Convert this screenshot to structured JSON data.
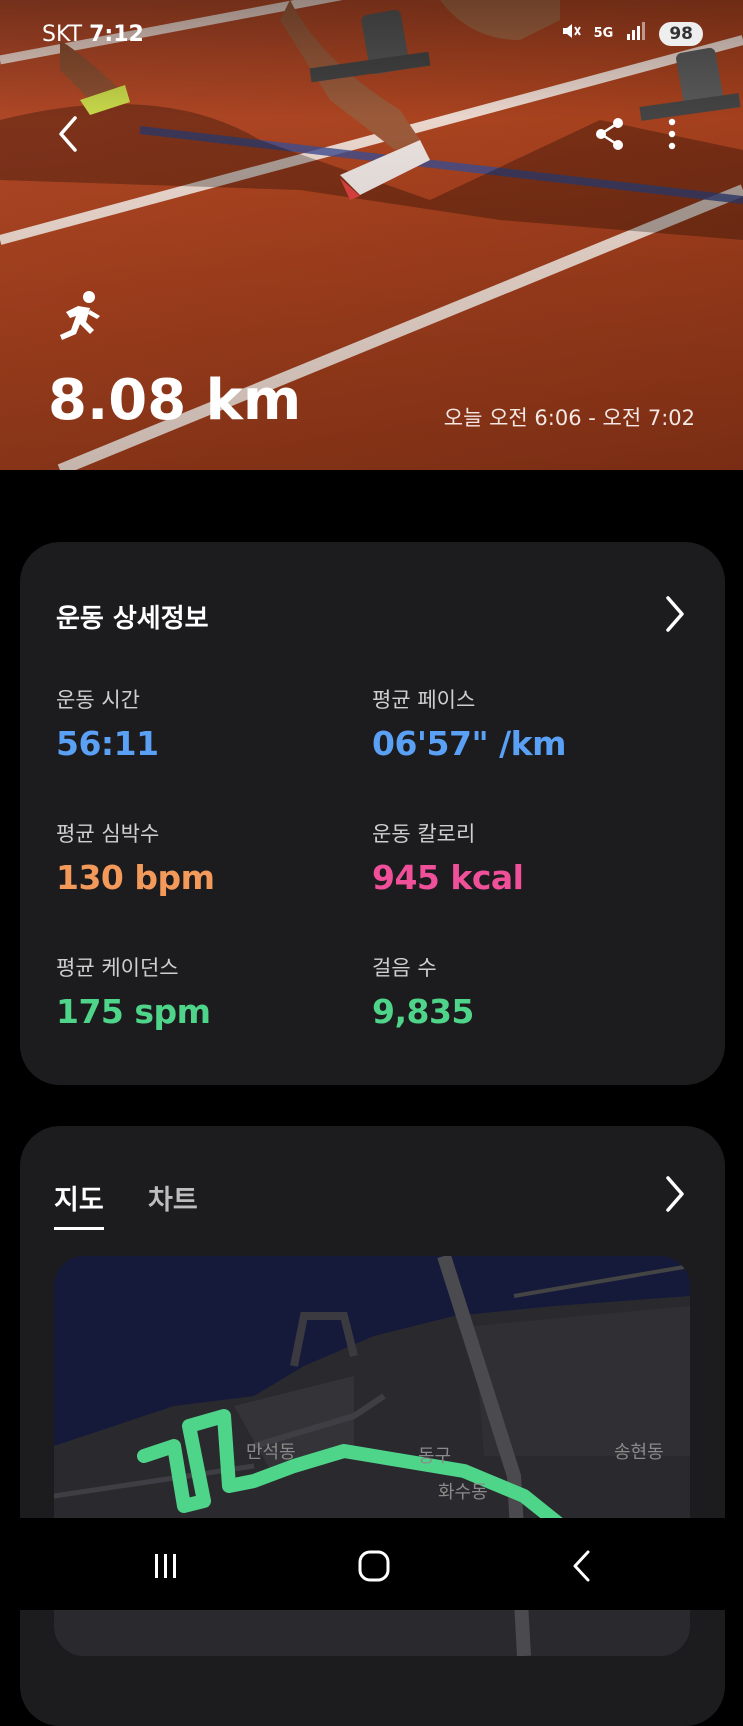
{
  "status_bar": {
    "carrier": "SKT",
    "time": "7:12",
    "network": "5G",
    "battery": "98"
  },
  "header": {
    "activity_icon": "running-person-icon",
    "distance": "8.08 km",
    "time_range": "오늘 오전 6:06 - 오전 7:02"
  },
  "details": {
    "title": "운동 상세정보",
    "metrics": [
      {
        "label": "운동 시간",
        "value": "56:11",
        "color": "#5aa0f5"
      },
      {
        "label": "평균 페이스",
        "value": "06'57\" /km",
        "color": "#5aa0f5"
      },
      {
        "label": "평균 심박수",
        "value": "130 bpm",
        "color": "#f39a5a"
      },
      {
        "label": "운동 칼로리",
        "value": "945 kcal",
        "color": "#f0509a"
      },
      {
        "label": "평균 케이던스",
        "value": "175 spm",
        "color": "#4fd58a"
      },
      {
        "label": "걸음 수",
        "value": "9,835",
        "color": "#4fd58a"
      }
    ]
  },
  "map_section": {
    "tabs": [
      {
        "label": "지도",
        "active": true
      },
      {
        "label": "차트",
        "active": false
      }
    ],
    "map_labels": [
      "만석동",
      "동구",
      "화수동",
      "송현동"
    ],
    "route_color": "#4fd58a"
  }
}
